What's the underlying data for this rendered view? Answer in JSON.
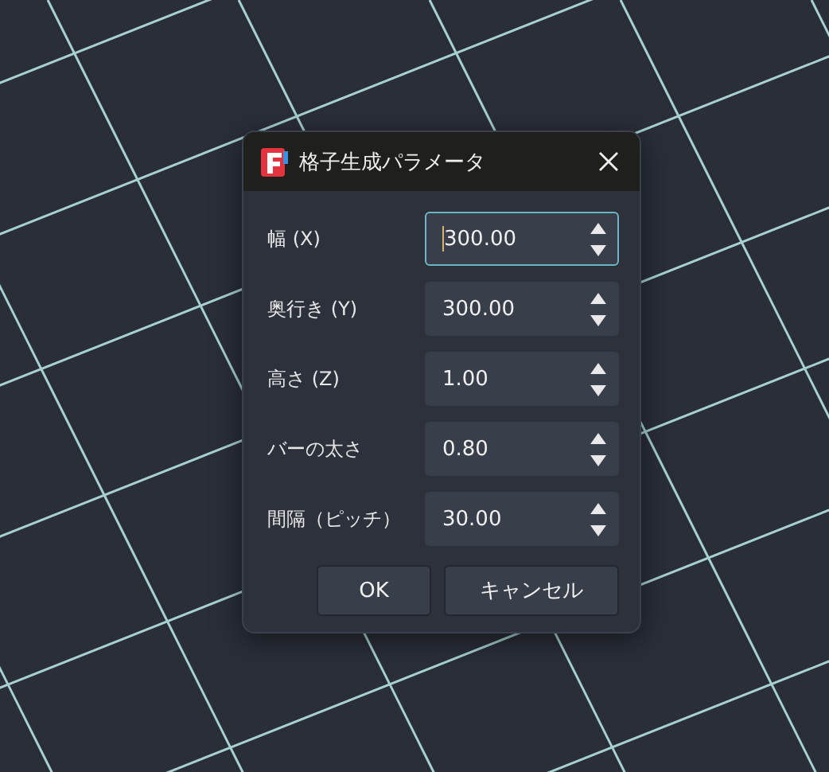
{
  "dialog": {
    "title": "格子生成パラメータ"
  },
  "fields": [
    {
      "label": "幅 (X)",
      "value": "300.00",
      "focused": true
    },
    {
      "label": "奥行き (Y)",
      "value": "300.00",
      "focused": false
    },
    {
      "label": "高さ (Z)",
      "value": "1.00",
      "focused": false
    },
    {
      "label": "バーの太さ",
      "value": "0.80",
      "focused": false
    },
    {
      "label": "間隔（ピッチ）",
      "value": "30.00",
      "focused": false
    }
  ],
  "buttons": [
    "OK",
    "キャンセル"
  ]
}
